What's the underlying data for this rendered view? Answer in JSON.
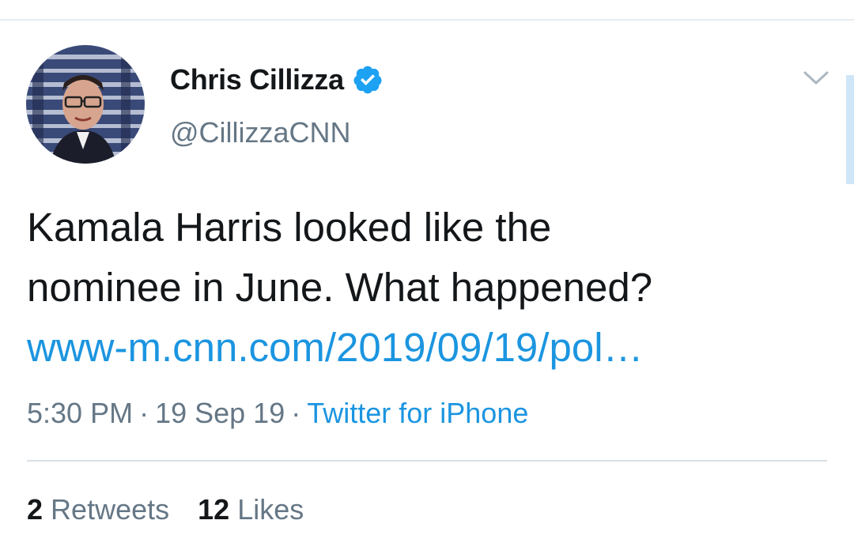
{
  "tweet": {
    "author": {
      "name": "Chris Cillizza",
      "handle": "@CillizzaCNN",
      "verified": true
    },
    "text_line1": "Kamala Harris looked like the",
    "text_line2": "nominee in June. What happened?",
    "link": "www-m.cnn.com/2019/09/19/pol…",
    "time": "5:30 PM",
    "separator1": "·",
    "date": "19 Sep 19",
    "separator2": "·",
    "source": "Twitter for iPhone",
    "retweets": {
      "count": "2",
      "label": "Retweets"
    },
    "likes": {
      "count": "12",
      "label": "Likes"
    }
  },
  "colors": {
    "text": "#14171a",
    "secondary": "#657786",
    "link": "#1b95e0",
    "verified_badge": "#1da1f2"
  },
  "icons": {
    "verified": "verified-badge-icon",
    "menu": "chevron-down-icon"
  }
}
